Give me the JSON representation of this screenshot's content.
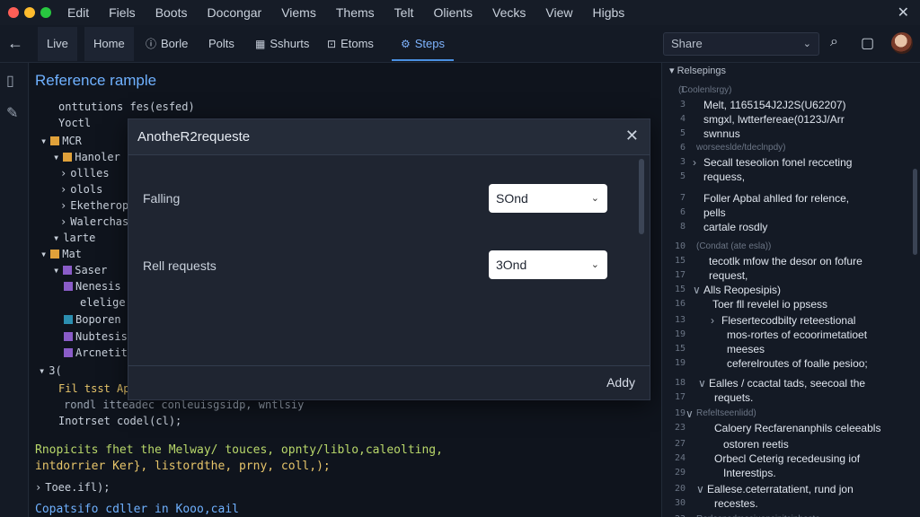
{
  "menubar": {
    "items": [
      "Edit",
      "Fiels",
      "Boots",
      "Docongar",
      "Viems",
      "Thems",
      "Telt",
      "Olients",
      "Vecks",
      "View",
      "Higbs"
    ]
  },
  "toolbar": {
    "tabs": [
      "Live",
      "Home",
      "Borle",
      "Polts",
      "Sshurts",
      "Etoms",
      "Steps"
    ],
    "share_label": "Share",
    "colors": {
      "accent": "#4a90e2"
    }
  },
  "editor": {
    "title": "Reference rample",
    "lines": [
      "onttutions fes(esfed)",
      "Yoctl",
      "MCR",
      "Hanoler",
      "ollles",
      "olols",
      "Eketherop",
      "Walerchas",
      "larte",
      "Mat",
      "Saser",
      "Nenesis",
      "elelige",
      "Boporen",
      "Nubtesis",
      "Arcnetits",
      "3(",
      "Fil tsst Apl",
      "rondl itteadec conleuisgsidp, wntlsiy",
      "Inotrset codel(cl);"
    ],
    "code_big_1": "Rnopicits fhet the Melway/ touces, opnty/liblo,caleolting,",
    "code_big_2": "intdorrier Ker}, listordthe, prny, coll,);",
    "code_big_3": "Toee.ifl);",
    "code_big_4": "Copatsifo cdller in Kooo,cail"
  },
  "modal": {
    "title": "AnotheR2requeste",
    "field1_label": "Falling",
    "field1_value": "SOnd",
    "field2_label": "Rell requests",
    "field2_value": "3Ond",
    "apply_label": "Addy"
  },
  "right_panel": {
    "header": "Relsepings",
    "lines": [
      {
        "num": "1",
        "text": "(Coolenlsrgy)",
        "dim": true
      },
      {
        "num": "3",
        "text": "Melt, 1165154J2J2S(U62207)"
      },
      {
        "num": "4",
        "text": "smgxl, lwtterfereae(0123J/Arr"
      },
      {
        "num": "5",
        "text": "swnnus"
      },
      {
        "num": "6",
        "text": "worseeslde/tdeclnpdy)",
        "dim": true
      },
      {
        "num": "3",
        "text": "Secall teseolion fonel recceting"
      },
      {
        "num": "5",
        "text": "requess,"
      },
      {
        "num": "7",
        "text": "Foller Apbal ahlled for relence,"
      },
      {
        "num": "6",
        "text": "pells"
      },
      {
        "num": "8",
        "text": "cartale rosdly"
      },
      {
        "num": "10",
        "text": "(Condat (ate esla))",
        "dim": true
      },
      {
        "num": "15",
        "text": "tecotlk mfow the desor on fofure"
      },
      {
        "num": "17",
        "text": "request,"
      },
      {
        "num": "15",
        "text": "Alls Reopesipis)"
      },
      {
        "num": "16",
        "text": "Toer fll revelel io ppsess"
      },
      {
        "num": "13",
        "text": "Flesertecodbilty reteestional"
      },
      {
        "num": "19",
        "text": "mos-rortes of ecoorimetatioet"
      },
      {
        "num": "15",
        "text": "meeses"
      },
      {
        "num": "19",
        "text": "ceferelroutes of foalle pesioo;"
      },
      {
        "num": "18",
        "text": "Ealles / ccactal tads, seecoal the"
      },
      {
        "num": "17",
        "text": "requets."
      },
      {
        "num": "19",
        "text": "Refeltseenlidd)",
        "dim": true
      },
      {
        "num": "23",
        "text": "Caloery Recfarenanphils celeeabls"
      },
      {
        "num": "27",
        "text": "ostoren reetis"
      },
      {
        "num": "24",
        "text": "Orbecl Ceterig recedeusing iof"
      },
      {
        "num": "29",
        "text": "Interestips."
      },
      {
        "num": "20",
        "text": "Eallese.ceterratatient, rund jon"
      },
      {
        "num": "30",
        "text": "recestes."
      },
      {
        "num": "23",
        "text": "Rorlesnsdmesiuapsinitsiphesto",
        "dim": true
      }
    ]
  }
}
